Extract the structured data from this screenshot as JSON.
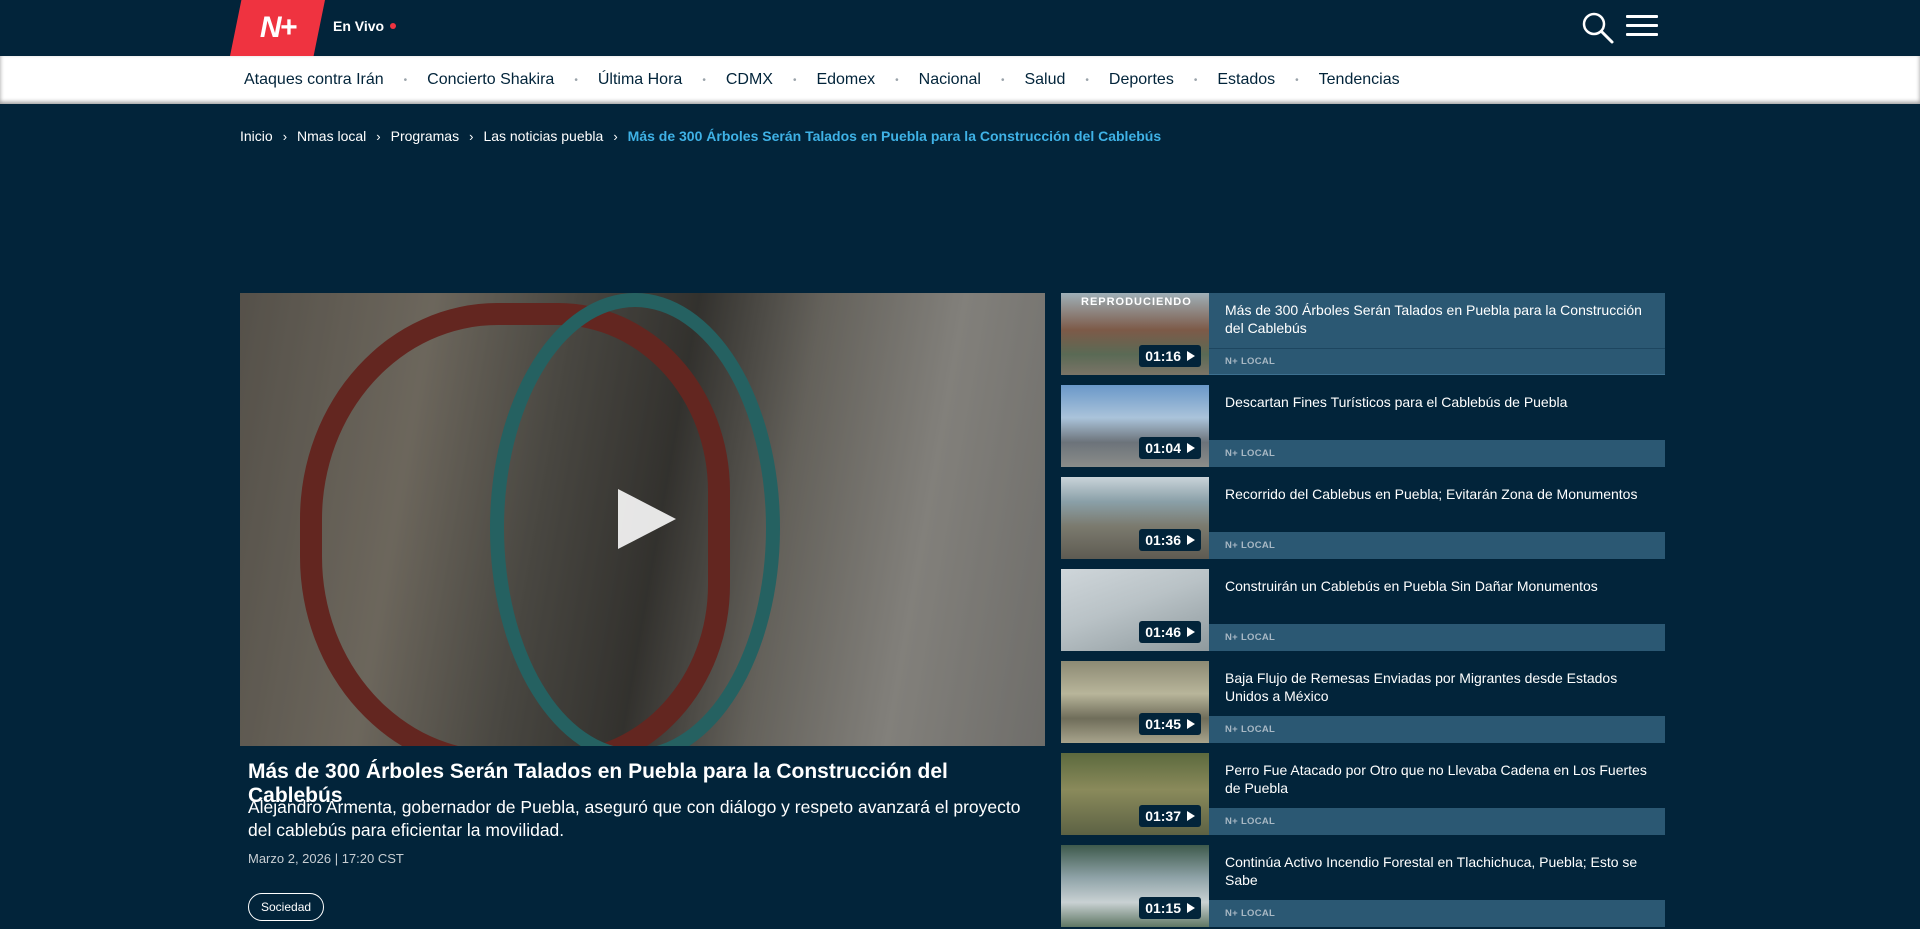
{
  "header": {
    "logo_text": "N+",
    "live_label": "En Vivo",
    "icons": [
      "search-icon",
      "menu-icon"
    ]
  },
  "nav": {
    "items": [
      "Ataques contra Irán",
      "Concierto Shakira",
      "Última Hora",
      "CDMX",
      "Edomex",
      "Nacional",
      "Salud",
      "Deportes",
      "Estados",
      "Tendencias"
    ],
    "separator": "•"
  },
  "breadcrumb": {
    "items": [
      "Inicio",
      "Nmas local",
      "Programas",
      "Las noticias puebla"
    ],
    "current": "Más de 300 Árboles Serán Talados en Puebla para la Construcción del Cablebús"
  },
  "article": {
    "title": "Más de 300 Árboles Serán Talados en Puebla para la Construcción del Cablebús",
    "summary": "Alejandro Armenta, gobernador de Puebla, aseguró que con diálogo y respeto avanzará el proyecto del cablebús para eficientar la movilidad.",
    "date": "Marzo 2, 2026 | 17:20 CST",
    "tag": "Sociedad"
  },
  "playlist": {
    "playing_label": "REPRODUCIENDO",
    "items": [
      {
        "title": "Más de 300 Árboles Serán Talados en Puebla para la Construcción del Cablebús",
        "duration": "01:16",
        "source": "N+ LOCAL"
      },
      {
        "title": "Descartan Fines Turísticos para el Cablebús de Puebla",
        "duration": "01:04",
        "source": "N+ LOCAL"
      },
      {
        "title": "Recorrido del Cablebus en Puebla; Evitarán Zona de Monumentos",
        "duration": "01:36",
        "source": "N+ LOCAL"
      },
      {
        "title": "Construirán un Cablebús en Puebla Sin Dañar Monumentos",
        "duration": "01:46",
        "source": "N+ LOCAL"
      },
      {
        "title": "Baja Flujo de Remesas Enviadas por Migrantes desde Estados Unidos a México",
        "duration": "01:45",
        "source": "N+ LOCAL"
      },
      {
        "title": "Perro Fue Atacado por Otro que no Llevaba Cadena en Los Fuertes de Puebla",
        "duration": "01:37",
        "source": "N+ LOCAL"
      },
      {
        "title": "Continúa Activo Incendio Forestal en Tlachichuca, Puebla; Esto se Sabe",
        "duration": "01:15",
        "source": "N+ LOCAL"
      }
    ]
  },
  "colors": {
    "background": "#02243a",
    "brand_red": "#ef3340",
    "accent_blue": "#3fb2e6",
    "playlist_bar": "#2b5873"
  }
}
